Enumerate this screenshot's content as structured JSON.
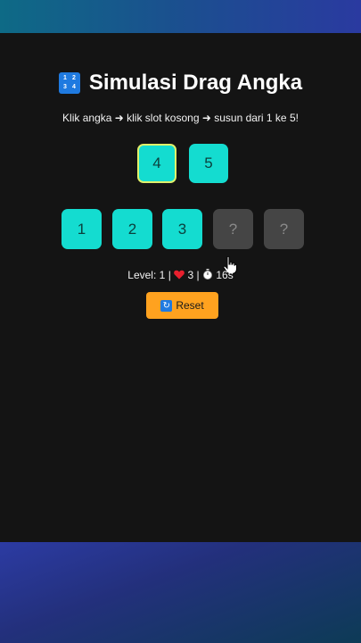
{
  "game": {
    "title_icon": "1234-numbers-icon",
    "title": "Simulasi Drag Angka",
    "instruction": "Klik angka ➜ klik slot kosong ➜ susun dari 1 ke 5!",
    "pool": [
      {
        "label": "4",
        "selected": true
      },
      {
        "label": "5",
        "selected": false
      }
    ],
    "slots": [
      {
        "label": "1",
        "state": "filled"
      },
      {
        "label": "2",
        "state": "filled"
      },
      {
        "label": "3",
        "state": "filled"
      },
      {
        "label": "?",
        "state": "empty"
      },
      {
        "label": "?",
        "state": "empty"
      }
    ],
    "status": {
      "level_label": "Level:",
      "level": "1",
      "separator": "|",
      "lives_icon": "heart-icon",
      "lives": "3",
      "timer_icon": "stopwatch-icon",
      "time": "16s"
    },
    "reset_icon": "refresh-icon",
    "reset_label": "Reset"
  },
  "colors": {
    "tile": "#14dcd0",
    "selected_border": "#dff06a",
    "empty_slot": "#454545",
    "reset_button": "#ffa21f",
    "background": "#141414"
  }
}
